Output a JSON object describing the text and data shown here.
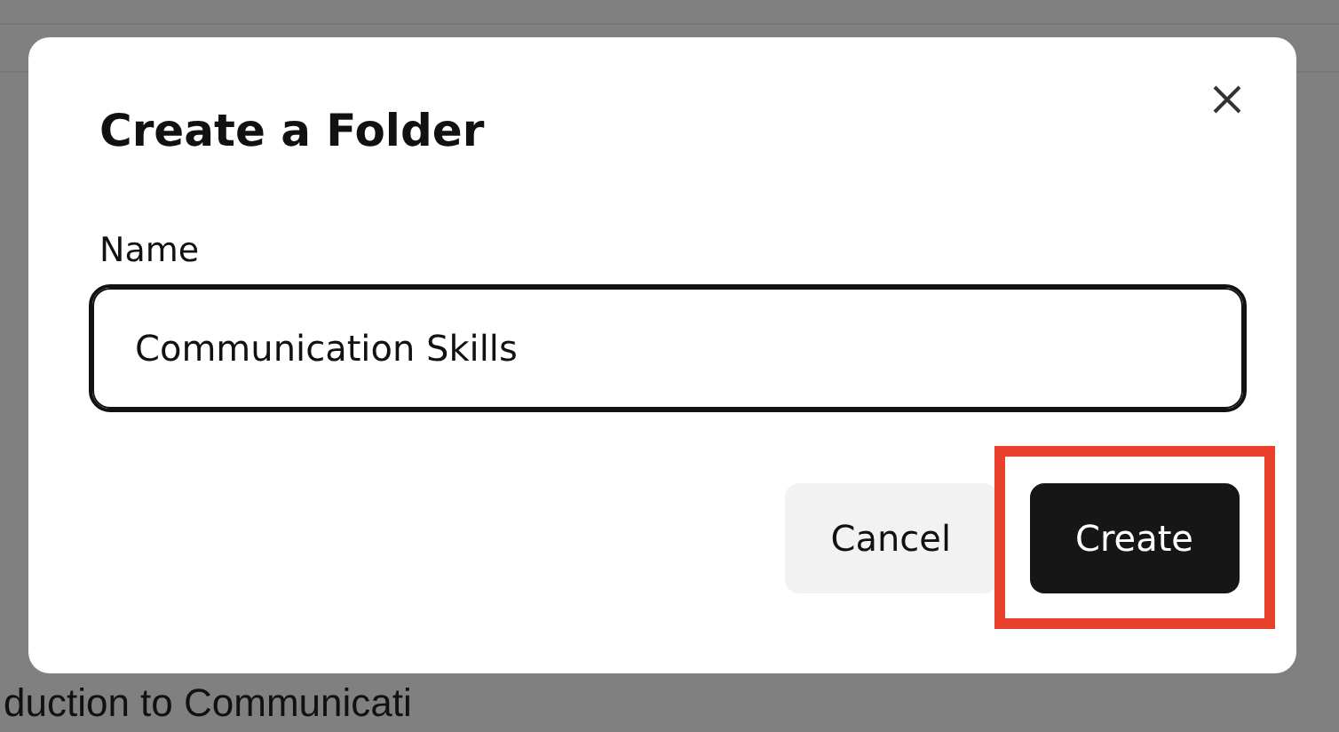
{
  "background": {
    "heading": "duction to Communicati"
  },
  "dialog": {
    "title": "Create a Folder",
    "field": {
      "label": "Name",
      "value": "Communication Skills",
      "focused": true
    },
    "buttons": [
      {
        "label": "Cancel",
        "kind": "secondary",
        "highlighted": false
      },
      {
        "label": "Create",
        "kind": "primary",
        "highlighted": true
      }
    ]
  }
}
